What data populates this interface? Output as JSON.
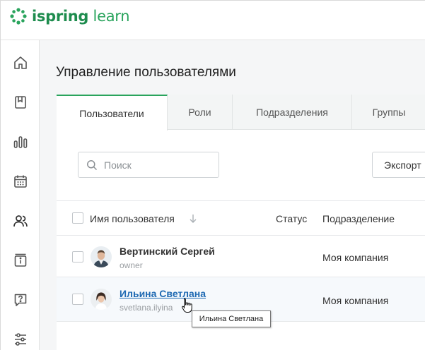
{
  "brand": {
    "name_bold": "ispring",
    "name_light": " learn",
    "accent": "#2aa45d",
    "dark_accent": "#1e8c4e"
  },
  "sidebar": {
    "items": [
      {
        "icon": "home-icon"
      },
      {
        "icon": "book-icon"
      },
      {
        "icon": "reports-icon"
      },
      {
        "icon": "calendar-icon"
      },
      {
        "icon": "users-icon",
        "active": true
      },
      {
        "icon": "info-icon"
      },
      {
        "icon": "question-icon"
      },
      {
        "icon": "settings-icon"
      }
    ]
  },
  "page": {
    "title": "Управление пользователями"
  },
  "tabs": [
    {
      "label": "Пользователи",
      "active": true
    },
    {
      "label": "Роли"
    },
    {
      "label": "Подразделения"
    },
    {
      "label": "Группы"
    }
  ],
  "toolbar": {
    "search_placeholder": "Поиск",
    "export_label": "Экспорт"
  },
  "table": {
    "columns": {
      "name": "Имя пользователя",
      "status": "Статус",
      "department": "Подразделение"
    },
    "rows": [
      {
        "name": "Вертинский Сергей",
        "login": "owner",
        "status": "",
        "department": "Моя компания"
      },
      {
        "name": "Ильина Светлана",
        "login": "svetlana.ilyina",
        "status": "",
        "department": "Моя компания"
      }
    ]
  },
  "tooltip": {
    "text": "Ильина Светлана"
  }
}
